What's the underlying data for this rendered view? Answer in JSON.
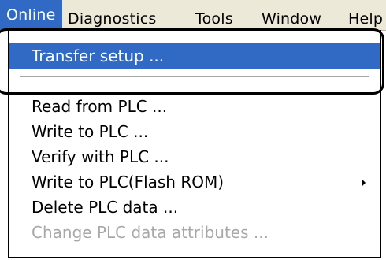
{
  "menubar": {
    "items": [
      {
        "label": "Online",
        "active": true
      },
      {
        "label": "Diagnostics",
        "active": false
      },
      {
        "label": "Tools",
        "active": false
      },
      {
        "label": "Window",
        "active": false
      },
      {
        "label": "Help",
        "active": false
      }
    ]
  },
  "menu": {
    "items": [
      {
        "label": "Transfer setup ...",
        "state": "highlighted"
      },
      {
        "label": "Read from PLC ...",
        "state": "enabled"
      },
      {
        "label": "Write to PLC ...",
        "state": "enabled"
      },
      {
        "label": "Verify with PLC ...",
        "state": "enabled"
      },
      {
        "label": "Write to PLC(Flash ROM)",
        "state": "enabled",
        "submenu": true
      },
      {
        "label": "Delete PLC data ...",
        "state": "enabled"
      },
      {
        "label": "Change PLC data attributes ...",
        "state": "disabled"
      }
    ]
  },
  "colors": {
    "highlight": "#316ac5",
    "highlight_text": "#ffffff",
    "disabled_text": "#a8a8a8",
    "menubar_bg": "#ece9d8",
    "callout": "#000000"
  },
  "icons": {
    "submenu": "chevron-right-icon"
  }
}
